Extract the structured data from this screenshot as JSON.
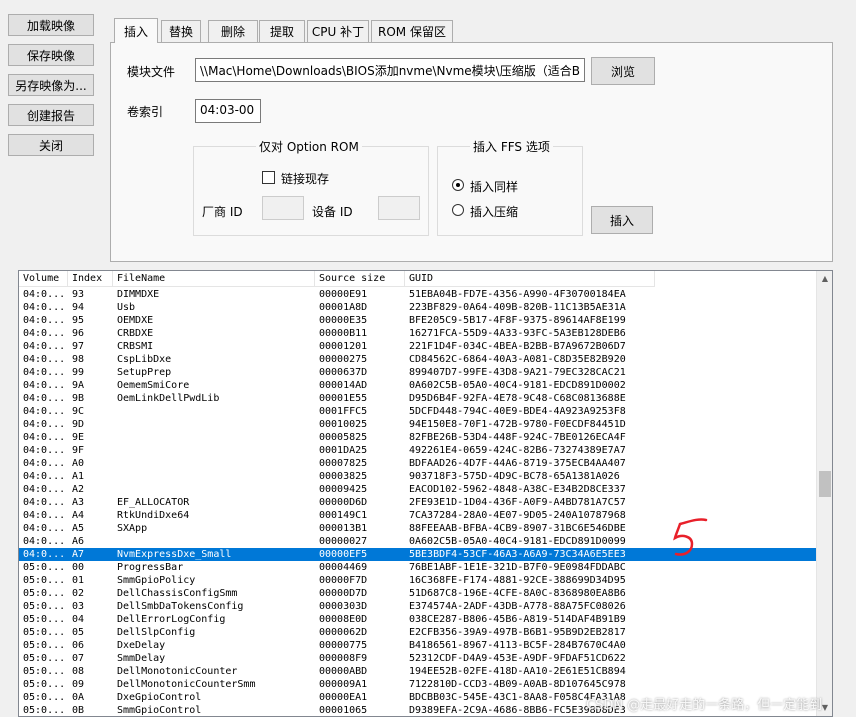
{
  "sidebar": {
    "load": "加载映像",
    "save": "保存映像",
    "save_as": "另存映像为...",
    "report": "创建报告",
    "close": "关闭"
  },
  "tabs": [
    "插入",
    "替换",
    "删除",
    "提取",
    "CPU 补丁",
    "ROM 保留区"
  ],
  "insert": {
    "module_file_label": "模块文件",
    "module_file_value": "\\\\Mac\\Home\\Downloads\\BIOS添加nvme\\Nvme模块\\压缩版（适合B",
    "browse": "浏览",
    "volume_label": "卷索引",
    "volume_value": "04:03-00",
    "option_rom_title": "仅对 Option ROM",
    "link_existing": "链接现存",
    "vendor_id_label": "厂商 ID",
    "device_id_label": "设备 ID",
    "ffs_title": "插入 FFS 选项",
    "insert_same": "插入同样",
    "insert_compressed": "插入压缩",
    "insert_button": "插入"
  },
  "table": {
    "columns": [
      "Volume",
      "Index",
      "FileName",
      "Source size",
      "GUID"
    ],
    "rows": [
      [
        "04:0...",
        "93",
        "DIMMDXE",
        "00000E91",
        "51EBA04B-FD7E-4356-A990-4F30700184EA"
      ],
      [
        "04:0...",
        "94",
        "Usb",
        "00001A8D",
        "223BF829-0A64-409B-820B-11C13B5AE31A"
      ],
      [
        "04:0...",
        "95",
        "OEMDXE",
        "00000E35",
        "BFE205C9-5B17-4F8F-9375-89614AF8E199"
      ],
      [
        "04:0...",
        "96",
        "CRBDXE",
        "00000B11",
        "16271FCA-55D9-4A33-93FC-5A3EB128DEB6"
      ],
      [
        "04:0...",
        "97",
        "CRBSMI",
        "00001201",
        "221F1D4F-034C-4BEA-B2BB-B7A9672B06D7"
      ],
      [
        "04:0...",
        "98",
        "CspLibDxe",
        "00000275",
        "CD84562C-6864-40A3-A081-C8D35E82B920"
      ],
      [
        "04:0...",
        "99",
        "SetupPrep",
        "0000637D",
        "899407D7-99FE-43D8-9A21-79EC328CAC21"
      ],
      [
        "04:0...",
        "9A",
        "OememSmiCore",
        "000014AD",
        "0A602C5B-05A0-40C4-9181-EDCD891D0002"
      ],
      [
        "04:0...",
        "9B",
        "OemLinkDellPwdLib",
        "00001E55",
        "D95D6B4F-92FA-4E78-9C48-C68C0813688E"
      ],
      [
        "04:0...",
        "9C",
        "",
        "0001FFC5",
        "5DCFD448-794C-40E9-BDE4-4A923A9253F8"
      ],
      [
        "04:0...",
        "9D",
        "",
        "00010025",
        "94E150E8-70F1-472B-9780-F0ECDF84451D"
      ],
      [
        "04:0...",
        "9E",
        "",
        "00005825",
        "82FBE26B-53D4-448F-924C-7BE0126ECA4F"
      ],
      [
        "04:0...",
        "9F",
        "",
        "0001DA25",
        "492261E4-0659-424C-82B6-73274389E7A7"
      ],
      [
        "04:0...",
        "A0",
        "",
        "00007825",
        "BDFAAD26-4D7F-44A6-8719-375ECB4AA407"
      ],
      [
        "04:0...",
        "A1",
        "",
        "00003825",
        "903718F3-575D-4D9C-BC78-65A1381A026"
      ],
      [
        "04:0...",
        "A2",
        "",
        "00009425",
        "EACOD102-5962-4848-A38C-E34B2D8CE337"
      ],
      [
        "04:0...",
        "A3",
        "EF_ALLOCATOR",
        "00000D6D",
        "2FE93E1D-1D04-436F-A0F9-A4BD781A7C57"
      ],
      [
        "04:0...",
        "A4",
        "RtkUndiDxe64",
        "000149C1",
        "7CA37284-28A0-4E07-9D05-240A10787968"
      ],
      [
        "04:0...",
        "A5",
        "SXApp",
        "000013B1",
        "88FEEAAB-BFBA-4CB9-8907-31BC6E546DBE"
      ],
      [
        "04:0...",
        "A6",
        "",
        "00000027",
        "0A602C5B-05A0-40C4-9181-EDCD891D0099"
      ],
      [
        "04:0...",
        "A7",
        "NvmExpressDxe_Small",
        "00000EF5",
        "5BE3BDF4-53CF-46A3-A6A9-73C34A6E5EE3"
      ],
      [
        "05:0...",
        "00",
        "ProgressBar",
        "00004469",
        "76BE1ABF-1E1E-321D-B7F0-9E0984FDDABC"
      ],
      [
        "05:0...",
        "01",
        "SmmGpioPolicy",
        "00000F7D",
        "16C368FE-F174-4881-92CE-388699D34D95"
      ],
      [
        "05:0...",
        "02",
        "DellChassisConfigSmm",
        "00000D7D",
        "51D687C8-196E-4CFE-8A0C-8368980EA8B6"
      ],
      [
        "05:0...",
        "03",
        "DellSmbDaTokensConfig",
        "0000303D",
        "E374574A-2ADF-43DB-A778-88A75FC08026"
      ],
      [
        "05:0...",
        "04",
        "DellErrorLogConfig",
        "00008E0D",
        "038CE287-B806-45B6-A819-514DAF4B91B9"
      ],
      [
        "05:0...",
        "05",
        "DellSlpConfig",
        "0000062D",
        "E2CFB356-39A9-497B-B6B1-95B9D2EB2817"
      ],
      [
        "05:0...",
        "06",
        "DxeDelay",
        "00000775",
        "B4186561-8967-4113-BC5F-284B7670C4A0"
      ],
      [
        "05:0...",
        "07",
        "SmmDelay",
        "000008F9",
        "52312CDF-D4A9-453E-A9DF-9FDAF51CD622"
      ],
      [
        "05:0...",
        "08",
        "DellMonotonicCounter",
        "00000ABD",
        "194EE52B-02FE-418D-AA10-2E61E51CB894"
      ],
      [
        "05:0...",
        "09",
        "DellMonotonicCounterSmm",
        "000009A1",
        "7122810D-CCD3-4B09-A0AB-8D107645C978"
      ],
      [
        "05:0...",
        "0A",
        "DxeGpioControl",
        "00000EA1",
        "BDCBB03C-545E-43C1-8AA8-F058C4FA31A8"
      ],
      [
        "05:0...",
        "0B",
        "SmmGpioControl",
        "00001065",
        "D9389EFA-2C9A-4686-8BB6-FC5E398D8DE3"
      ]
    ],
    "selected_index": 20
  },
  "watermark": "CSDN @走最好走的一条路，但一定能到"
}
